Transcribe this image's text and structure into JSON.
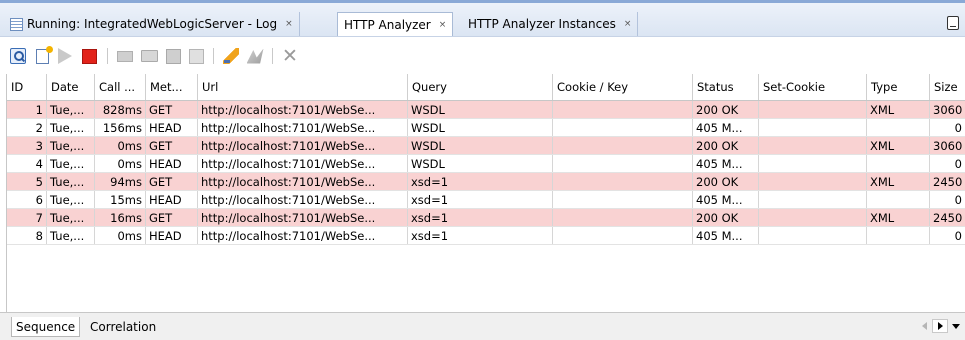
{
  "tabs": [
    {
      "label": "Running: IntegratedWebLogicServer - Log",
      "close": "×",
      "active": false,
      "icon": "log-document-icon"
    },
    {
      "label": "HTTP Analyzer",
      "close": "×",
      "active": true
    },
    {
      "label": "HTTP Analyzer Instances",
      "close": "×",
      "active": false
    }
  ],
  "toolbar": {
    "icons": [
      "search-icon",
      "new-request-icon",
      "start-icon",
      "stop-icon",
      "clear-icon",
      "open-icon",
      "save-icon",
      "find-icon",
      "edit-request-icon",
      "replay-icon",
      "delete-icon"
    ]
  },
  "table": {
    "columns": [
      "ID",
      "Date",
      "Call ...",
      "Met...",
      "Url",
      "Query",
      "Cookie / Key",
      "Status",
      "Set-Cookie",
      "Type",
      "Size"
    ],
    "rows": [
      {
        "id": "1",
        "date": "Tue,...",
        "call": "828ms",
        "method": "GET",
        "url": "http://localhost:7101/WebSe...",
        "query": "WSDL",
        "cookie": "",
        "status": "200 OK",
        "setcookie": "",
        "type": "XML",
        "size": "3060"
      },
      {
        "id": "2",
        "date": "Tue,...",
        "call": "156ms",
        "method": "HEAD",
        "url": "http://localhost:7101/WebSe...",
        "query": "WSDL",
        "cookie": "",
        "status": "405 M...",
        "setcookie": "",
        "type": "",
        "size": "0"
      },
      {
        "id": "3",
        "date": "Tue,...",
        "call": "0ms",
        "method": "GET",
        "url": "http://localhost:7101/WebSe...",
        "query": "WSDL",
        "cookie": "",
        "status": "200 OK",
        "setcookie": "",
        "type": "XML",
        "size": "3060"
      },
      {
        "id": "4",
        "date": "Tue,...",
        "call": "0ms",
        "method": "HEAD",
        "url": "http://localhost:7101/WebSe...",
        "query": "WSDL",
        "cookie": "",
        "status": "405 M...",
        "setcookie": "",
        "type": "",
        "size": "0"
      },
      {
        "id": "5",
        "date": "Tue,...",
        "call": "94ms",
        "method": "GET",
        "url": "http://localhost:7101/WebSe...",
        "query": "xsd=1",
        "cookie": "",
        "status": "200 OK",
        "setcookie": "",
        "type": "XML",
        "size": "2450"
      },
      {
        "id": "6",
        "date": "Tue,...",
        "call": "15ms",
        "method": "HEAD",
        "url": "http://localhost:7101/WebSe...",
        "query": "xsd=1",
        "cookie": "",
        "status": "405 M...",
        "setcookie": "",
        "type": "",
        "size": "0"
      },
      {
        "id": "7",
        "date": "Tue,...",
        "call": "16ms",
        "method": "GET",
        "url": "http://localhost:7101/WebSe...",
        "query": "xsd=1",
        "cookie": "",
        "status": "200 OK",
        "setcookie": "",
        "type": "XML",
        "size": "2450"
      },
      {
        "id": "8",
        "date": "Tue,...",
        "call": "0ms",
        "method": "HEAD",
        "url": "http://localhost:7101/WebSe...",
        "query": "xsd=1",
        "cookie": "",
        "status": "405 M...",
        "setcookie": "",
        "type": "",
        "size": "0"
      }
    ]
  },
  "bottom_tabs": [
    {
      "label": "Sequence",
      "active": true
    },
    {
      "label": "Correlation",
      "active": false
    }
  ],
  "colors": {
    "highlight_row": "#f9d2d2",
    "tab_bar": "#dbe5f3",
    "stop": "#e2231a"
  }
}
